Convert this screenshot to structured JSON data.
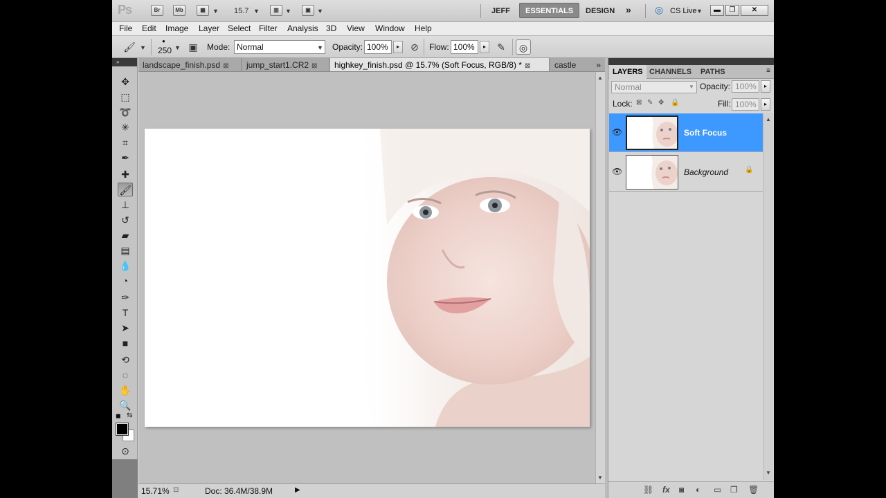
{
  "app": {
    "logo": "Ps",
    "bridge_label": "Br",
    "minibridge_label": "Mb",
    "zoom": "15.7",
    "workspaces": [
      "JEFF",
      "ESSENTIALS",
      "DESIGN"
    ],
    "workspaces_more": "»",
    "cs_live": "CS Live"
  },
  "menu": [
    "File",
    "Edit",
    "Image",
    "Layer",
    "Select",
    "Filter",
    "Analysis",
    "3D",
    "View",
    "Window",
    "Help"
  ],
  "options": {
    "brush_size": "250",
    "mode_label": "Mode:",
    "mode_value": "Normal",
    "opacity_label": "Opacity:",
    "opacity_value": "100%",
    "flow_label": "Flow:",
    "flow_value": "100%"
  },
  "tabs": [
    {
      "label": "landscape_finish.psd",
      "close": "⊠"
    },
    {
      "label": "jump_start1.CR2",
      "close": "⊠"
    },
    {
      "label": "highkey_finish.psd @ 15.7% (Soft Focus, RGB/8) *",
      "close": "⊠"
    },
    {
      "label": "castle",
      "close": ""
    }
  ],
  "tabs_more": "»",
  "status": {
    "zoom": "15.71%",
    "doc": "Doc: 36.4M/38.9M"
  },
  "layers_panel": {
    "tabs": [
      "LAYERS",
      "CHANNELS",
      "PATHS"
    ],
    "blend_mode": "Normal",
    "opacity_label": "Opacity:",
    "opacity_value": "100%",
    "lock_label": "Lock:",
    "fill_label": "Fill:",
    "fill_value": "100%",
    "layers": [
      {
        "name": "Soft Focus",
        "selected": true
      },
      {
        "name": "Background",
        "selected": false
      }
    ]
  },
  "colors": {
    "selection": "#3d98ff",
    "foreground": "#000000",
    "background": "#ffffff"
  }
}
